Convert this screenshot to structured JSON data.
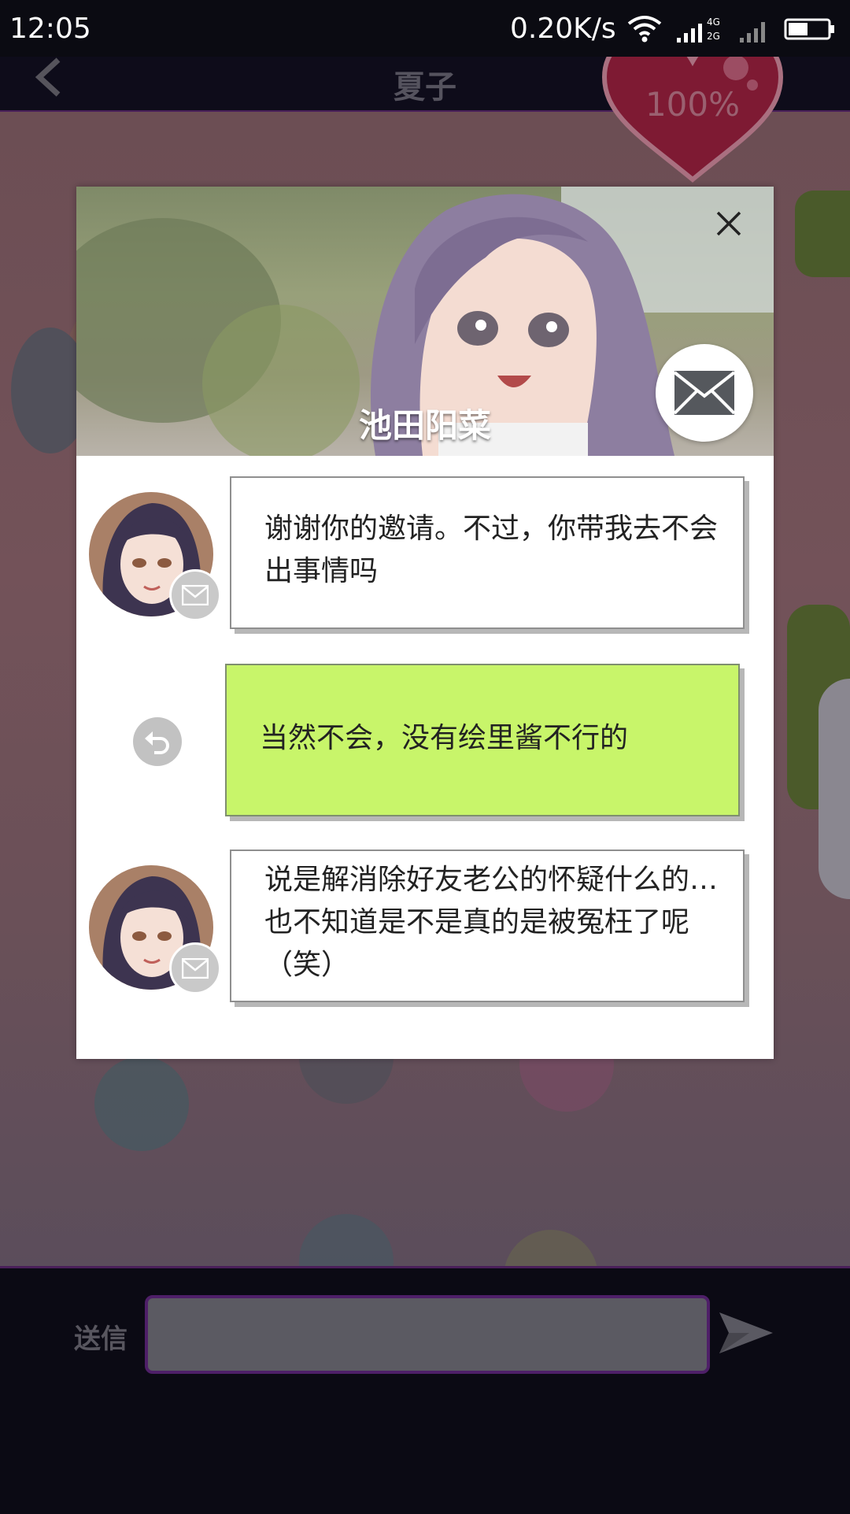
{
  "status_bar": {
    "time": "12:05",
    "net_speed": "0.20K/s",
    "icons": [
      "wifi-icon",
      "signal-4g-icon",
      "signal-2g-icon",
      "battery-icon"
    ]
  },
  "header": {
    "title": "夏子",
    "affection": "100%"
  },
  "modal": {
    "character_name": "池田阳菜",
    "messages": [
      {
        "sender": "character",
        "text": "谢谢你的邀请。不过，你带我去不会出事情吗"
      },
      {
        "sender": "player",
        "text": "当然不会，没有绘里酱不行的"
      },
      {
        "sender": "character",
        "text": "说是解消除好友老公的怀疑什么的…也不知道是不是真的是被冤枉了呢（笑）"
      }
    ]
  },
  "input_bar": {
    "label": "送信",
    "value": ""
  },
  "colors": {
    "accent_purple": "#4e1f68",
    "player_bubble": "#c8f56a",
    "heart": "#8e1a35"
  }
}
